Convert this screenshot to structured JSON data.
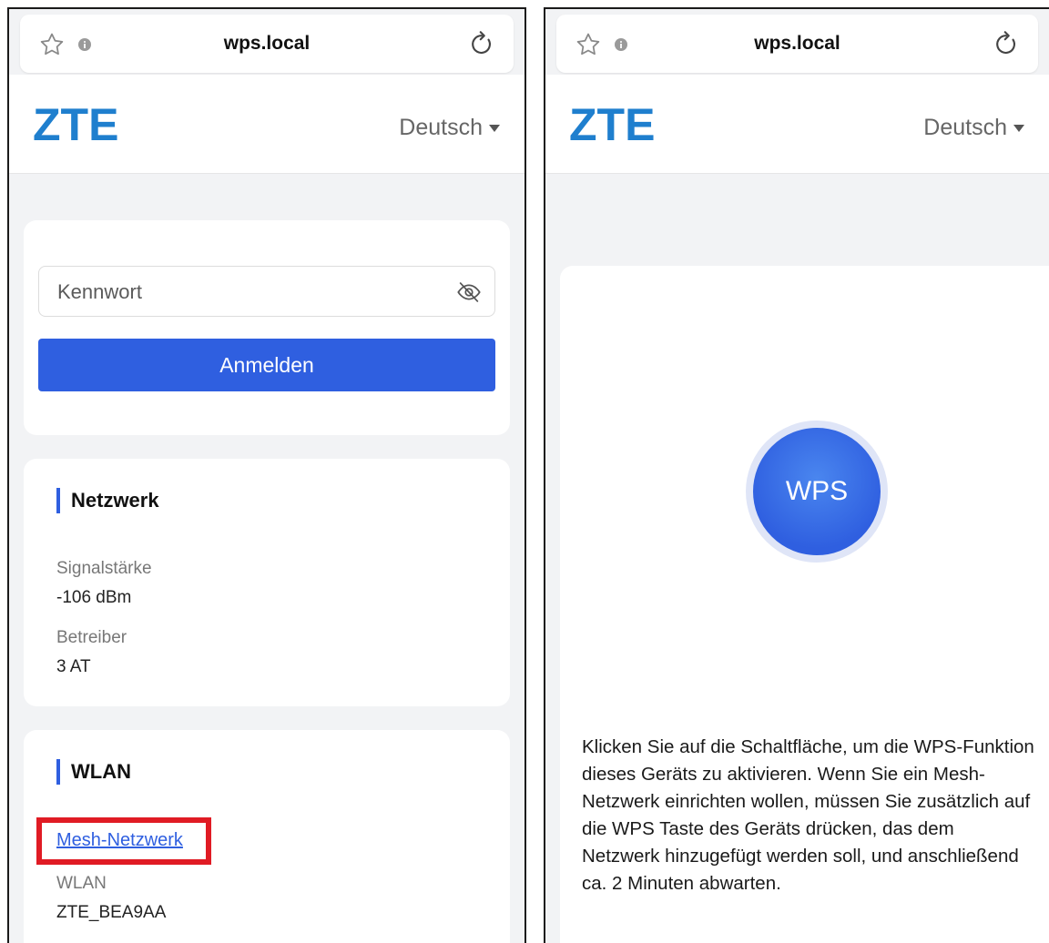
{
  "browser": {
    "domain": "wps.local"
  },
  "header": {
    "logo_text": "ZTE",
    "language": "Deutsch"
  },
  "login": {
    "password_placeholder": "Kennwort",
    "submit_label": "Anmelden"
  },
  "network": {
    "title": "Netzwerk",
    "signal_label": "Signalstärke",
    "signal_value": "-106 dBm",
    "operator_label": "Betreiber",
    "operator_value": "3 AT"
  },
  "wlan": {
    "title": "WLAN",
    "mesh_link": "Mesh-Netzwerk",
    "ssid_label": "WLAN",
    "ssid_value": "ZTE_BEA9AA"
  },
  "wps": {
    "button_label": "WPS",
    "description": "Klicken Sie auf die Schaltfläche, um die WPS-Funktion dieses Geräts zu aktivieren. Wenn Sie ein Mesh-Netzwerk einrichten wollen, müssen Sie zusätzlich auf die WPS Taste des Geräts drücken, das dem Netzwerk hinzugefügt werden soll, und anschließend ca. 2 Minuten abwarten."
  },
  "colors": {
    "brand_blue": "#2f5fe0",
    "logo_blue": "#1f7fce",
    "highlight_red": "#e01b24"
  },
  "icons": [
    "star-icon",
    "info-icon",
    "reload-icon",
    "caret-down-icon",
    "eye-off-icon"
  ]
}
